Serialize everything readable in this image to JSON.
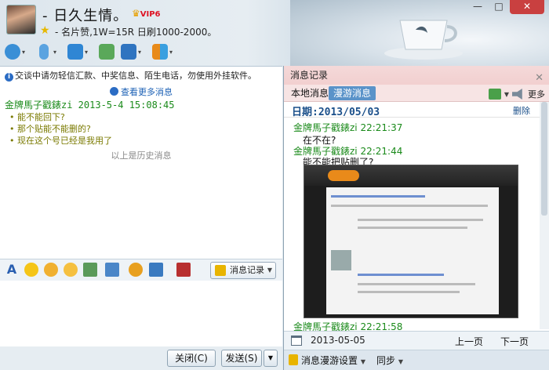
{
  "header": {
    "nickname": "- 日久生情。",
    "vip_badge": "VIP6",
    "signature": "- 名片赞,1W=15R 日刷1000-2000。",
    "window_buttons": {
      "min": "—",
      "max": "□",
      "close": "✕"
    }
  },
  "toolbar": {
    "items": [
      {
        "icon": "video-camera-icon",
        "color": "#3a8fd6"
      },
      {
        "icon": "microphone-icon",
        "color": "#5aa3e0"
      },
      {
        "icon": "file-transfer-icon",
        "color": "#2f86d4"
      },
      {
        "icon": "add-contact-icon",
        "color": "#5aa85a"
      },
      {
        "icon": "screen-share-icon",
        "color": "#2f74c0"
      },
      {
        "icon": "apps-icon",
        "color": "#e88a1a"
      }
    ]
  },
  "chat": {
    "notice": "交谈中请勿轻信汇款、中奖信息、陌生电话，勿使用外挂软件。",
    "more_messages": "查看更多消息",
    "sender_line": "金牌馬子戳錶zi 2013-5-4 15:08:45",
    "history_lines": [
      "能不能回下?",
      "那个贴能不能删的?",
      "现在这个号已经是我用了"
    ],
    "history_divider": "以上是历史消息"
  },
  "input_toolbar": {
    "icons": [
      "font-icon",
      "emoji-icon",
      "magic-emoji-icon",
      "shake-icon",
      "screenshot-icon",
      "image-icon",
      "music-icon",
      "send-screen-icon",
      "gift-icon"
    ],
    "message_log_label": "消息记录"
  },
  "actions": {
    "close_label": "关闭(C)",
    "send_label": "发送(S)",
    "send_arrow": "▼"
  },
  "history": {
    "title": "消息记录",
    "tabs": {
      "local": "本地消息",
      "roam": "漫游消息"
    },
    "more_label": "更多",
    "date_label": "日期:2013/05/03",
    "delete_label": "删除",
    "messages": [
      {
        "sender": "金牌馬子戳錶zi 22:21:37",
        "text": "在不在?"
      },
      {
        "sender": "金牌馬子戳錶zi 22:21:44",
        "text": "能不能把贴删了?"
      },
      {
        "sender": "金牌馬子戳錶zi 22:21:58",
        "text": ""
      }
    ],
    "footer_date": "2013-05-05",
    "prev_page": "上一页",
    "next_page": "下一页",
    "roam_settings": "消息漫游设置",
    "sync": "同步"
  }
}
